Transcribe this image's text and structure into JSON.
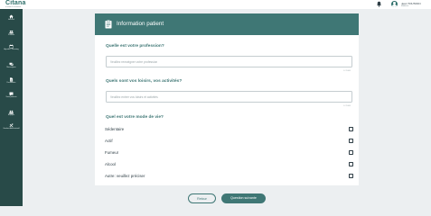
{
  "app": {
    "logo": "Citana",
    "logo_sub": "e-santé & connecté"
  },
  "header": {
    "user_name": "Jean TOUTANN",
    "user_role": "Médecin"
  },
  "sidebar": {
    "items": [
      {
        "label": "Accueil",
        "icon": "home-icon"
      },
      {
        "label": "Patients",
        "icon": "users-icon"
      },
      {
        "label": "Agenda / Planning",
        "icon": "calendar-icon"
      },
      {
        "label": "Messagerie",
        "icon": "chat-icon"
      },
      {
        "label": "Demandes",
        "icon": "document-icon"
      },
      {
        "label": "Suivi patients",
        "icon": "message-icon"
      },
      {
        "label": "Équipes",
        "icon": "team-icon"
      },
      {
        "label": "Gestion Administratif",
        "icon": "tools-icon"
      }
    ]
  },
  "card": {
    "title": "Information patient"
  },
  "questions": {
    "profession": {
      "label": "Quelle est votre profession?",
      "placeholder": "Veuillez renseigner votre profession",
      "counter": "0 / 1000"
    },
    "loisirs": {
      "label": "Quels sont vos loisirs, vos activités?",
      "placeholder": "Veuillez entrer vos loisirs et activités",
      "counter": "0 / 1000"
    },
    "mode_vie": {
      "label": "Quel est votre mode de vie?",
      "options": [
        "Sédentaire",
        "Actif",
        "Fumeur",
        "Alcool",
        "Autre: veuillez préciser"
      ]
    }
  },
  "buttons": {
    "back": "Retour",
    "next": "Question suivante"
  },
  "colors": {
    "sidebar": "#284a48",
    "accent": "#3f7775",
    "background": "#eceff1"
  }
}
